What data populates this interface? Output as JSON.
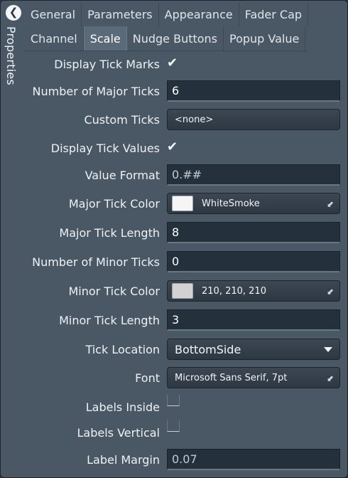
{
  "sidebar": {
    "title": "Properties",
    "back_glyph": "❮"
  },
  "tabs_row1": [
    "General",
    "Parameters",
    "Appearance",
    "Fader Cap"
  ],
  "tabs_row2": [
    "Channel",
    "Scale",
    "Nudge Buttons",
    "Popup Value"
  ],
  "active_tab": "Scale",
  "check_glyph": "✔",
  "corner_glyph": "⬋",
  "properties": {
    "display_tick_marks": {
      "label": "Display Tick Marks",
      "checked": true
    },
    "number_of_major_ticks": {
      "label": "Number of Major Ticks",
      "value": "6"
    },
    "custom_ticks": {
      "label": "Custom Ticks",
      "value": "<none>"
    },
    "display_tick_values": {
      "label": "Display Tick Values",
      "checked": true
    },
    "value_format": {
      "label": "Value Format",
      "value": "0.##"
    },
    "major_tick_color": {
      "label": "Major Tick Color",
      "value": "WhiteSmoke",
      "swatch": "#f5f5f5"
    },
    "major_tick_length": {
      "label": "Major Tick Length",
      "value": "8"
    },
    "number_of_minor_ticks": {
      "label": "Number of Minor Ticks",
      "value": "0"
    },
    "minor_tick_color": {
      "label": "Minor Tick Color",
      "value": "210, 210, 210",
      "swatch": "#d2d2d2"
    },
    "minor_tick_length": {
      "label": "Minor Tick Length",
      "value": "3"
    },
    "tick_location": {
      "label": "Tick Location",
      "value": "BottomSide"
    },
    "font": {
      "label": "Font",
      "value": "Microsoft Sans Serif, 7pt"
    },
    "labels_inside": {
      "label": "Labels Inside",
      "checked": false
    },
    "labels_vertical": {
      "label": "Labels Vertical",
      "checked": false
    },
    "label_margin": {
      "label": "Label Margin",
      "value": "0.07"
    }
  },
  "colors": {
    "panel_bg": "#4a5866",
    "input_bg": "#24303b",
    "active_tab_bg": "#5b6a78"
  }
}
